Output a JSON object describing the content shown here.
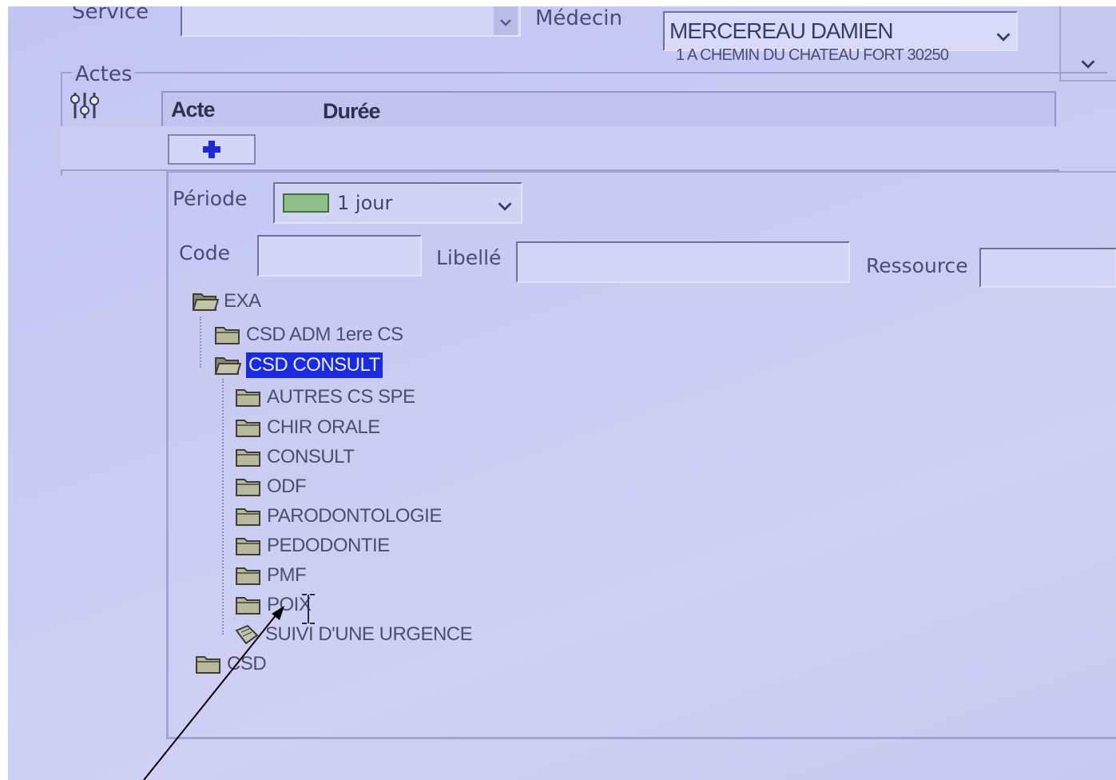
{
  "header": {
    "service_label": "Service",
    "medecin_label": "Médecin",
    "medecin_value": "MERCEREAU DAMIEN",
    "medecin_address": "1 A CHEMIN DU CHATEAU FORT 30250"
  },
  "actes": {
    "group_label": "Actes",
    "columns": [
      "Acte",
      "Durée"
    ],
    "add_button_icon": "plus-icon"
  },
  "filters": {
    "periode_label": "Période",
    "periode_value": "1 jour",
    "code_label": "Code",
    "code_value": "",
    "libelle_label": "Libellé",
    "libelle_value": "",
    "ressource_label": "Ressource",
    "ressource_value": ""
  },
  "tree": {
    "root": "EXA",
    "nodes": [
      {
        "label": "CSD ADM 1ere CS",
        "icon": "folder-closed-icon"
      },
      {
        "label": "CSD CONSULT",
        "icon": "folder-open-icon",
        "selected": true
      },
      {
        "label": "AUTRES CS SPE",
        "icon": "folder-closed-icon"
      },
      {
        "label": "CHIR ORALE",
        "icon": "folder-closed-icon"
      },
      {
        "label": "CONSULT",
        "icon": "folder-closed-icon"
      },
      {
        "label": "ODF",
        "icon": "folder-closed-icon"
      },
      {
        "label": "PARODONTOLOGIE",
        "icon": "folder-closed-icon"
      },
      {
        "label": "PEDODONTIE",
        "icon": "folder-closed-icon"
      },
      {
        "label": "PMF",
        "icon": "folder-closed-icon"
      },
      {
        "label": "POIX",
        "icon": "folder-closed-icon"
      },
      {
        "label": "SUIVI D'UNE URGENCE",
        "icon": "document-icon"
      },
      {
        "label": "CSD",
        "icon": "folder-closed-icon"
      }
    ]
  },
  "colors": {
    "selection": "#1a2ae0",
    "background": "#c8caf2",
    "arrow": "#000000"
  }
}
